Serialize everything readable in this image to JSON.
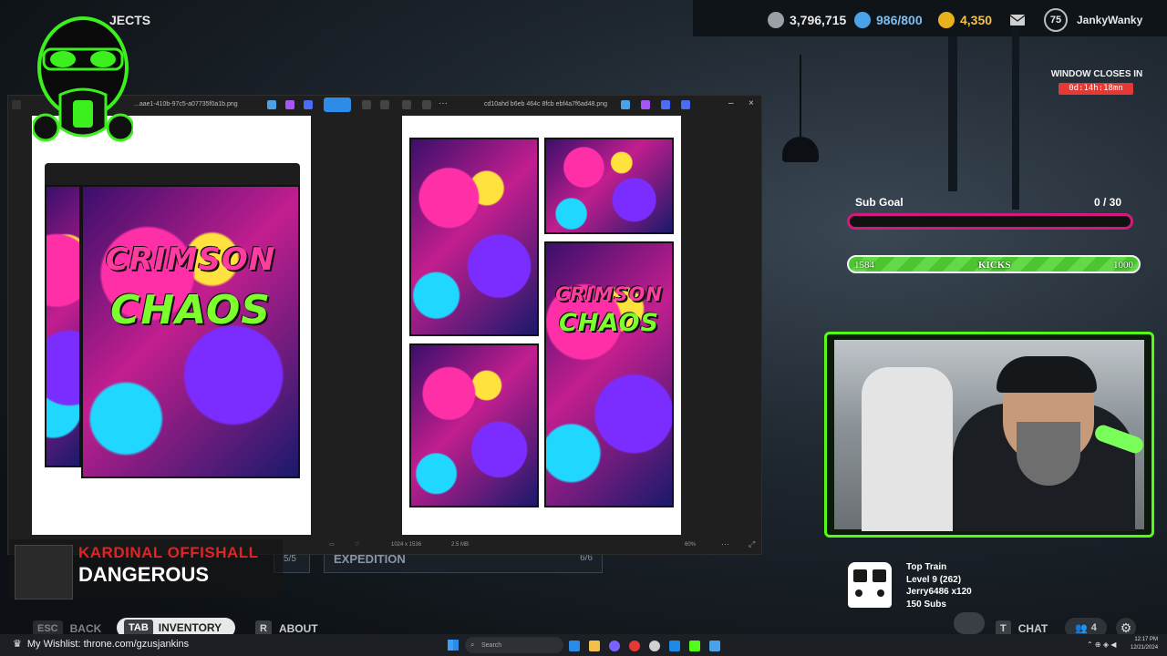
{
  "hud": {
    "projects_label": "JECTS",
    "currency1": "3,796,715",
    "currency2": "986/800",
    "currency3": "4,350",
    "level": "75",
    "username": "JankyWanky"
  },
  "window_timer": {
    "label": "WINDOW CLOSES IN",
    "value": "0d:14h:18mn"
  },
  "sub_goal": {
    "title": "Sub Goal",
    "count": "0 / 30",
    "progress": 0
  },
  "kicks": {
    "left": "1584",
    "label": "KICKS",
    "right": "1000"
  },
  "top_train": {
    "title": "Top Train",
    "level": "Level 9  (262)",
    "top": "Jerry6486 x120",
    "subs": "150 Subs"
  },
  "app_window": {
    "left_filename": "...aae1-410b-97c5-a07735f0a1b.png",
    "right_filename": "cd10ahd b6eb 464c 8fcb ebf4a7f6ad48.png",
    "zoom": "60%",
    "image_info": "1024 x 1536",
    "file_size": "2.5 MB"
  },
  "art": {
    "line1": "CRIMSON",
    "line2": "CHAOS"
  },
  "behind_labels": {
    "count1": "5/5",
    "expedition": "EXPEDITION",
    "count2": "6/6"
  },
  "chat_notification": {
    "name": "KARDINAL OFFISHALL",
    "message": "DANGEROUS"
  },
  "bottom_nav": {
    "esc_key": "ESC",
    "back": "BACK",
    "tab_key": "TAB",
    "inventory": "INVENTORY",
    "r_key": "R",
    "about": "ABOUT",
    "t_key": "T",
    "chat": "CHAT",
    "friends_count": "4"
  },
  "wishlist": "My Wishlist: throne.com/gzusjankins",
  "taskbar": {
    "search_placeholder": "Search",
    "time": "12:17 PM",
    "date": "12/21/2024"
  },
  "colors": {
    "kick_green": "#53fc18",
    "goal_pink": "#d31a7e",
    "timer_red": "#e53935"
  }
}
